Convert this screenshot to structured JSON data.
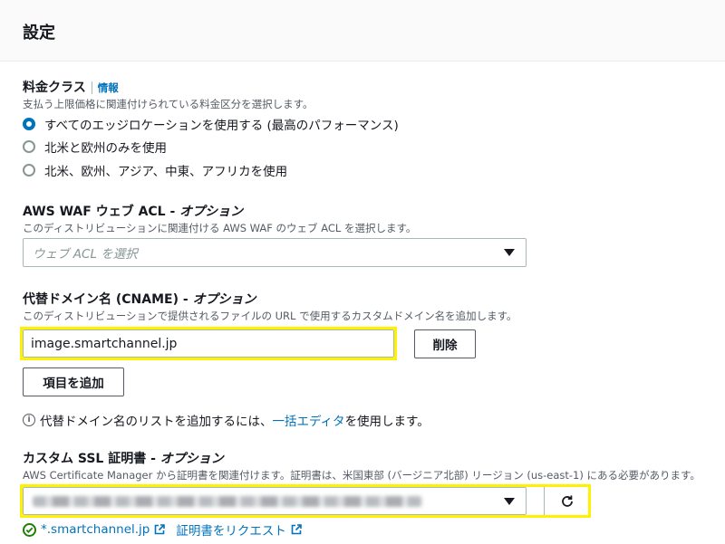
{
  "panel": {
    "title": "設定"
  },
  "price_class": {
    "label": "料金クラス",
    "info": "情報",
    "description": "支払う上限価格に関連付けられている料金区分を選択します。",
    "options": [
      {
        "label": "すべてのエッジロケーションを使用する (最高のパフォーマンス)",
        "selected": true
      },
      {
        "label": "北米と欧州のみを使用",
        "selected": false
      },
      {
        "label": "北米、欧州、アジア、中東、アフリカを使用",
        "selected": false
      }
    ]
  },
  "waf": {
    "label_main": "AWS WAF ウェブ ACL - ",
    "label_optional": "オプション",
    "description": "このディストリビューションに関連付ける AWS WAF のウェブ ACL を選択します。",
    "placeholder": "ウェブ ACL を選択"
  },
  "cname": {
    "label_main": "代替ドメイン名 (CNAME) - ",
    "label_optional": "オプション",
    "description": "このディストリビューションで提供されるファイルの URL で使用するカスタムドメイン名を追加します。",
    "value": "image.smartchannel.jp",
    "remove_label": "削除",
    "add_label": "項目を追加",
    "hint_prefix": "代替ドメイン名のリストを追加するには、",
    "hint_link": "一括エディタ",
    "hint_suffix": " を使用します。"
  },
  "ssl": {
    "label_main": "カスタム SSL 証明書 - ",
    "label_optional": "オプション",
    "description": "AWS Certificate Manager から証明書を関連付けます。証明書は、米国東部 (バージニア北部) リージョン (us-east-1) にある必要があります。",
    "status_text": "*.smartchannel.jp",
    "request_link": "証明書をリクエスト"
  },
  "colors": {
    "accent": "#0073bb",
    "highlight": "#fff200",
    "success": "#1d8102"
  },
  "icons": [
    "info-icon",
    "chevron-down-icon",
    "refresh-icon",
    "check-circle-icon",
    "external-link-icon"
  ]
}
